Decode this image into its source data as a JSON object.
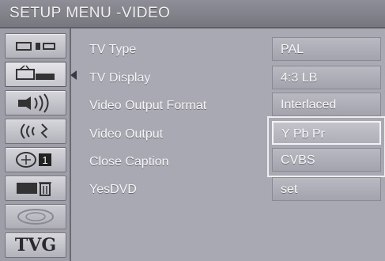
{
  "header": {
    "title": "SETUP MENU -VIDEO"
  },
  "sidebar": {
    "items": [
      {
        "icon": "speaker-panel-icon"
      },
      {
        "icon": "tv-display-icon",
        "active": true
      },
      {
        "icon": "audio-speaker-icon"
      },
      {
        "icon": "surround-sound-icon"
      },
      {
        "icon": "parental-lock-icon",
        "badge": "1"
      },
      {
        "icon": "trash-icon"
      },
      {
        "icon": "disc-icon"
      },
      {
        "icon": "tvg-icon",
        "label": "TVG"
      }
    ]
  },
  "menu": {
    "rows": [
      {
        "label": "TV Type",
        "value": "PAL"
      },
      {
        "label": "TV Display",
        "value": "4:3 LB"
      },
      {
        "label": "Video Output Format",
        "value": "Interlaced"
      },
      {
        "label": "Video Output",
        "value": "Y Pb Pr"
      },
      {
        "label": "Close Caption",
        "value": "CVBS"
      },
      {
        "label": "YesDVD",
        "value": "set"
      }
    ],
    "selected_row": "Video Output"
  },
  "colors": {
    "background": "#a9a9b3",
    "header": "#80808a",
    "text": "#f4f4f6",
    "highlight_border": "#f2f2f5"
  }
}
